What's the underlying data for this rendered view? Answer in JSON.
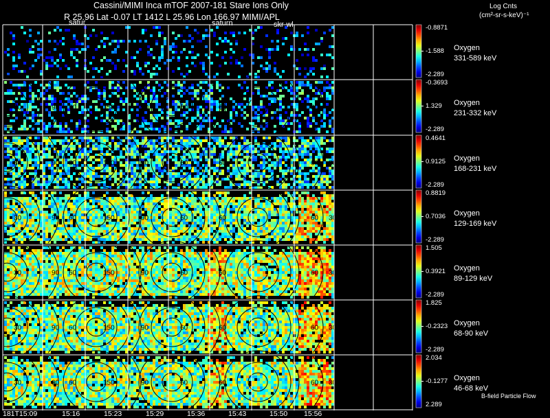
{
  "header": {
    "title_line_1": "Cassini/MIMI Inca mTOF  2007-181   Stare   Ions Only",
    "title_line_2": "R        25.96 Lat -0.07 LT 1412 L        25.96 Lon       166.97  MIMI/APL",
    "units_line_1": "Log Cnts",
    "units_line_2": "(cm²-sr-s-keV)⁻¹"
  },
  "tags": [
    "satur",
    "saturn",
    "skr-wl"
  ],
  "species": "Oxygen",
  "panels": [
    {
      "species": "Oxygen",
      "energy": "331-589 keV",
      "cb_max": "-0.8871",
      "cb_mid": "-1.588",
      "cb_min": "-2.289"
    },
    {
      "species": "Oxygen",
      "energy": "231-332 keV",
      "cb_max": "-0.3693",
      "cb_mid": "1.329",
      "cb_min": "-2.289"
    },
    {
      "species": "Oxygen",
      "energy": "168-231 keV",
      "cb_max": "0.4641",
      "cb_mid": "0.9125",
      "cb_min": "-2.289"
    },
    {
      "species": "Oxygen",
      "energy": "129-169 keV",
      "cb_max": "0.8819",
      "cb_mid": "0.7036",
      "cb_min": "-2.289"
    },
    {
      "species": "Oxygen",
      "energy": "89-129 keV",
      "cb_max": "1.505",
      "cb_mid": "0.3921",
      "cb_min": "-2.289"
    },
    {
      "species": "Oxygen",
      "energy": "68-90 keV",
      "cb_max": "1.825",
      "cb_mid": "-0.2323",
      "cb_min": "-2.289"
    },
    {
      "species": "Oxygen",
      "energy": "46-68 keV",
      "cb_max": "2.034",
      "cb_mid": "-0.1277",
      "cb_min": "2.289"
    }
  ],
  "time_axis": {
    "first_label": "181T15:09",
    "labels": [
      "15:16",
      "15:23",
      "15:29",
      "15:36",
      "15:43",
      "15:50",
      "15:56"
    ]
  },
  "contour_labels": [
    "30",
    "60",
    "90",
    "120",
    "150"
  ],
  "flow_label": "B-field Particle Flow",
  "colors": {
    "background": "#000000",
    "grid": "#ffffff",
    "contour": "#000000",
    "fill_low": "#0000ff",
    "fill_high": "#ff0000"
  }
}
